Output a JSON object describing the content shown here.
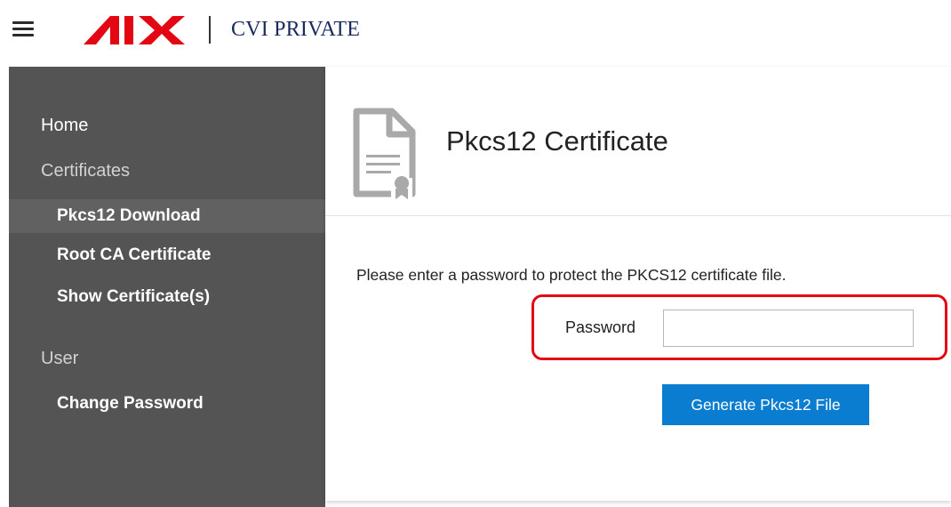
{
  "header": {
    "menu_icon": "hamburger-menu-icon",
    "logo_icon": "six-logo",
    "logo_color": "#e30613",
    "app_name": "CVI PRIVATE"
  },
  "sidebar": {
    "background": "#545454",
    "items": [
      {
        "label": "Home",
        "type": "section"
      },
      {
        "label": "Certificates",
        "type": "section-header"
      },
      {
        "label": "Pkcs12 Download",
        "type": "sub",
        "active": true
      },
      {
        "label": "Root CA Certificate",
        "type": "sub"
      },
      {
        "label": "Show Certificate(s)",
        "type": "sub"
      },
      {
        "label": "User",
        "type": "section-header"
      },
      {
        "label": "Change Password",
        "type": "sub"
      }
    ]
  },
  "main": {
    "icon": "certificate-document-icon",
    "title": "Pkcs12 Certificate",
    "instruction": "Please enter a password to protect the PKCS12 certificate file.",
    "password": {
      "label": "Password",
      "value": "",
      "placeholder": ""
    },
    "generate_button": "Generate Pkcs12 File",
    "accent_color": "#0a7dd1",
    "highlight_color": "#e30613"
  }
}
